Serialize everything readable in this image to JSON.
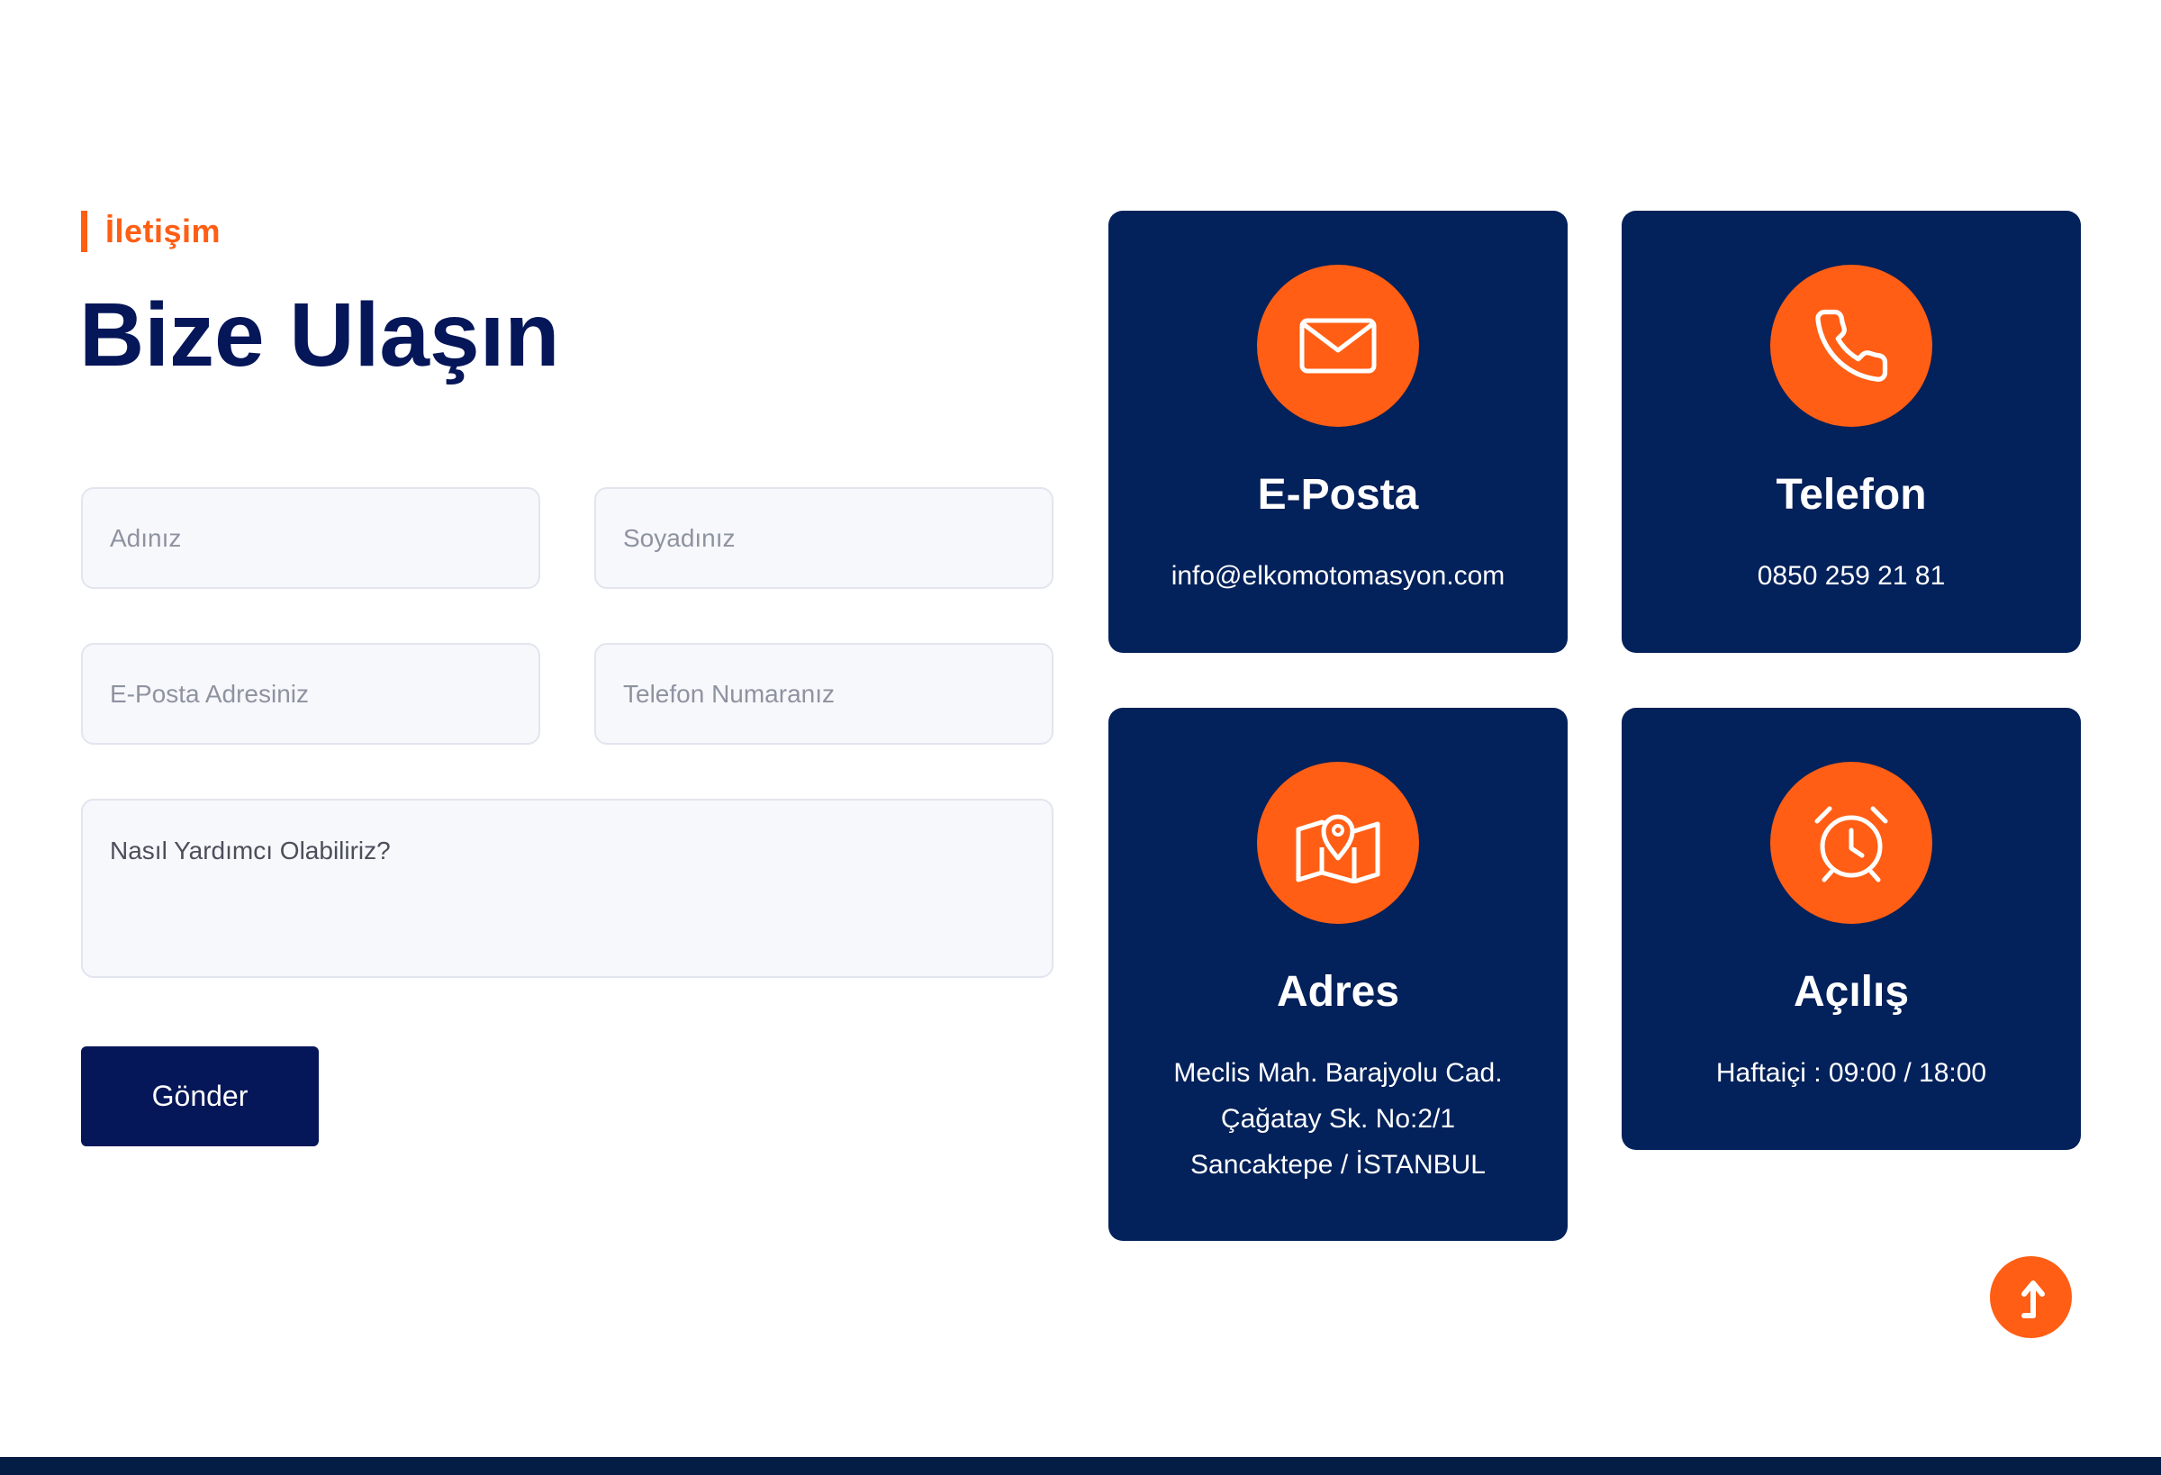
{
  "section": {
    "eyebrow": "İletişim",
    "title": "Bize Ulaşın"
  },
  "form": {
    "first_name_placeholder": "Adınız",
    "last_name_placeholder": "Soyadınız",
    "email_placeholder": "E-Posta Adresiniz",
    "phone_placeholder": "Telefon Numaranız",
    "message_placeholder": "Nasıl Yardımcı Olabiliriz?",
    "submit_label": "Gönder"
  },
  "cards": {
    "email": {
      "icon": "envelope-icon",
      "title": "E-Posta",
      "line1": "info@elkomotomasyon.com"
    },
    "phone": {
      "icon": "phone-icon",
      "title": "Telefon",
      "line1": "0850 259 21 81"
    },
    "address": {
      "icon": "map-icon",
      "title": "Adres",
      "line1": "Meclis Mah. Barajyolu Cad.",
      "line2": "Çağatay Sk. No:2/1",
      "line3": "Sancaktepe / İSTANBUL"
    },
    "hours": {
      "icon": "alarm-clock-icon",
      "title": "Açılış",
      "line1": "Haftaiçi : 09:00 / 18:00"
    }
  },
  "scroll_top": {
    "icon": "arrow-up-icon"
  },
  "colors": {
    "accent": "#ff5e14",
    "navy": "#051659",
    "card_bg": "#03215a",
    "field_bg": "#f7f8fc"
  }
}
